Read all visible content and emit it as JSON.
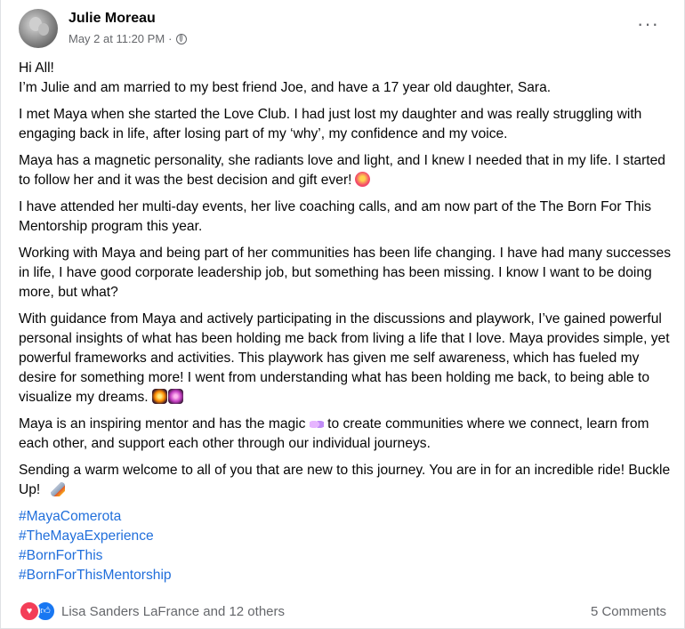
{
  "author": {
    "name": "Julie Moreau",
    "timestamp": "May 2 at 11:20 PM",
    "separator": "·",
    "audience_icon": "globe-icon"
  },
  "menu": {
    "more_label": "···"
  },
  "post": {
    "paragraphs": [
      {
        "text": "Hi All!"
      },
      {
        "text": "I’m Julie and am married to my best friend Joe, and have a 17 year old daughter, Sara."
      },
      {
        "text": "I met Maya when she started the Love Club. I had just lost my daughter and was really struggling with engaging back in life, after losing part of my ‘why’, my confidence and my voice."
      },
      {
        "text": "Maya has a magnetic personality, she radiants love and light, and I knew I needed that in my life. I started to follow her and it was the best decision and gift ever!",
        "emoji": "heart-gift-emoji"
      },
      {
        "text": "I have attended her multi-day events, her live coaching calls, and am now part of the The Born For This Mentorship program this year."
      },
      {
        "text": "Working with Maya and being part of her communities has been life changing.  I have had many successes in life, I have good corporate leadership job, but something has been missing.  I know I want to be doing more, but what?"
      },
      {
        "text": "With guidance from Maya and actively participating in the discussions and playwork, I’ve gained powerful personal insights of what has been holding me back from living a life that I love. Maya provides simple, yet powerful frameworks and activities.  This playwork has given me self awareness, which has fueled my desire for something more!  I went from understanding what has been holding me back, to being able to visualize my dreams.",
        "emoji": "fireworks-sparkles-emoji"
      },
      {
        "text_before": "Maya is an inspiring mentor and has the magic",
        "emoji": "butterfly-emoji",
        "text_after": "to create communities where we connect, learn from each other,  and support each other through our individual journeys."
      },
      {
        "text": "Sending a warm welcome to all of you that are new to this journey.  You are in for an incredible ride!  Buckle Up!",
        "emoji": "rocket-emoji"
      }
    ],
    "hashtags": [
      "#MayaComerota",
      "#TheMayaExperience",
      "#BornForThis",
      "#BornForThisMentorship"
    ]
  },
  "footer": {
    "reactions": [
      "love",
      "like"
    ],
    "reacted_by": "Lisa Sanders LaFrance and 12 others",
    "comments": "5 Comments"
  },
  "colors": {
    "link": "#216fdb",
    "secondary_text": "#65676b",
    "love": "#f33e58",
    "like": "#1877f2"
  }
}
